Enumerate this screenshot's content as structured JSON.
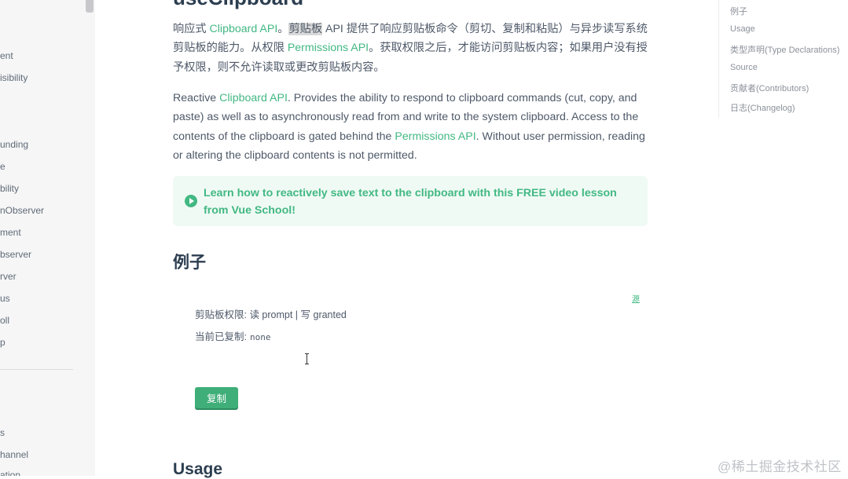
{
  "sidebar": {
    "items": [
      {
        "label": "ent"
      },
      {
        "label": "isibility"
      },
      {
        "label": "unding"
      },
      {
        "label": "e"
      },
      {
        "label": "bility"
      },
      {
        "label": "nObserver"
      },
      {
        "label": "ment"
      },
      {
        "label": "bserver"
      },
      {
        "label": "rver"
      },
      {
        "label": "us"
      },
      {
        "label": "oll"
      },
      {
        "label": "p"
      },
      {
        "label": "s"
      },
      {
        "label": "hannel"
      },
      {
        "label": "ation"
      }
    ]
  },
  "page": {
    "title": "useClipboard",
    "intro_zh": {
      "pre": "响应式 ",
      "link1": "Clipboard API",
      "mid1": "。",
      "highlight": "剪贴板",
      "mid2": " API 提供了响应剪贴板命令（剪切、复制和粘贴）与异步读写系统剪贴板的能力。从权限 ",
      "link2": "Permissions API",
      "post": "。获取权限之后，才能访问剪贴板内容；如果用户没有授予权限，则不允许读取或更改剪贴板内容。"
    },
    "intro_en": {
      "pre": "Reactive ",
      "link1": "Clipboard API",
      "mid": ". Provides the ability to respond to clipboard commands (cut, copy, and paste) as well as to asynchronously read from and write to the system clipboard. Access to the contents of the clipboard is gated behind the ",
      "link2": "Permissions API",
      "post": ". Without user permission, reading or altering the clipboard contents is not permitted."
    },
    "tip": "Learn how to reactively save text to the clipboard with this FREE video lesson from Vue School!",
    "example_heading": "例子",
    "demo": {
      "source_link": "源",
      "permissions_line": "剪贴板权限: 读 prompt | 写 granted",
      "copied_label": "当前已复制:",
      "copied_value": "none",
      "copy_button": "复制"
    },
    "usage_heading": "Usage"
  },
  "toc": {
    "items": [
      {
        "label": "例子"
      },
      {
        "label": "Usage"
      },
      {
        "label": "类型声明(Type Declarations)"
      },
      {
        "label": "Source"
      },
      {
        "label": "贡献者(Contributors)"
      },
      {
        "label": "日志(Changelog)"
      }
    ]
  },
  "watermark": "@稀土掘金技术社区",
  "colors": {
    "accent": "#42b883",
    "tip_bg": "#f0faf4",
    "sidebar_bg": "#f6f6f7"
  }
}
